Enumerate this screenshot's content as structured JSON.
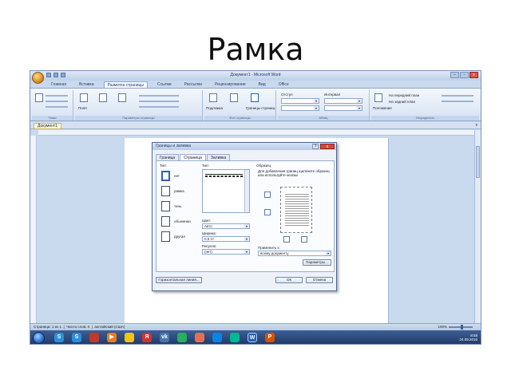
{
  "slide": {
    "title": "Рамка"
  },
  "window": {
    "title": "Документ1 - Microsoft Word",
    "controls": [
      "–",
      "▫",
      "x"
    ]
  },
  "ribbon": {
    "tabs": [
      "Главная",
      "Вставка",
      "Разметка страницы",
      "Ссылки",
      "Рассылки",
      "Рецензирование",
      "Вид",
      "Office"
    ],
    "active_tab_index": 2,
    "groups": [
      "Темы",
      "Параметры страницы",
      "Фон страницы",
      "Абзац",
      "Упорядочить"
    ],
    "items": {
      "margins": "Поля",
      "page_color": "Цвет страницы",
      "page_borders": "Границы страниц",
      "watermark": "Подложка",
      "indent": "Отступ",
      "spacing": "Интервал",
      "position": "Положение",
      "bring_forward": "На передний план",
      "send_backward": "На задний план"
    }
  },
  "document": {
    "tab_label": "Документ1",
    "close": "x"
  },
  "dialog": {
    "title": "Границы и заливка",
    "help": "?",
    "close": "x",
    "tabs": [
      "Граница",
      "Страница",
      "Заливка"
    ],
    "active_tab_index": 1,
    "type_label": "Тип:",
    "types": [
      "нет",
      "рамка",
      "тень",
      "объемная",
      "другая"
    ],
    "selected_type_index": 0,
    "style_label": "Тип:",
    "color_label": "Цвет:",
    "color_value": "Авто",
    "width_label": "Ширина:",
    "width_value": "0,5 пт",
    "art_label": "Рисунок:",
    "art_value": "(нет)",
    "preview_label": "Образец",
    "preview_hint": "Для добавления границ щелкните образец или используйте кнопки",
    "apply_label": "Применить к:",
    "apply_value": "всему документу",
    "options_button": "Параметры...",
    "hline_button": "Горизонтальная линия...",
    "ok_button": "ОК",
    "cancel_button": "Отмена"
  },
  "status": {
    "page": "Страница: 1 из 1",
    "words": "Число слов: 0",
    "language": "английский (США)",
    "zoom": "100%"
  },
  "taskbar": {
    "clock_time": "8:58",
    "clock_date": "24.09.2016"
  }
}
